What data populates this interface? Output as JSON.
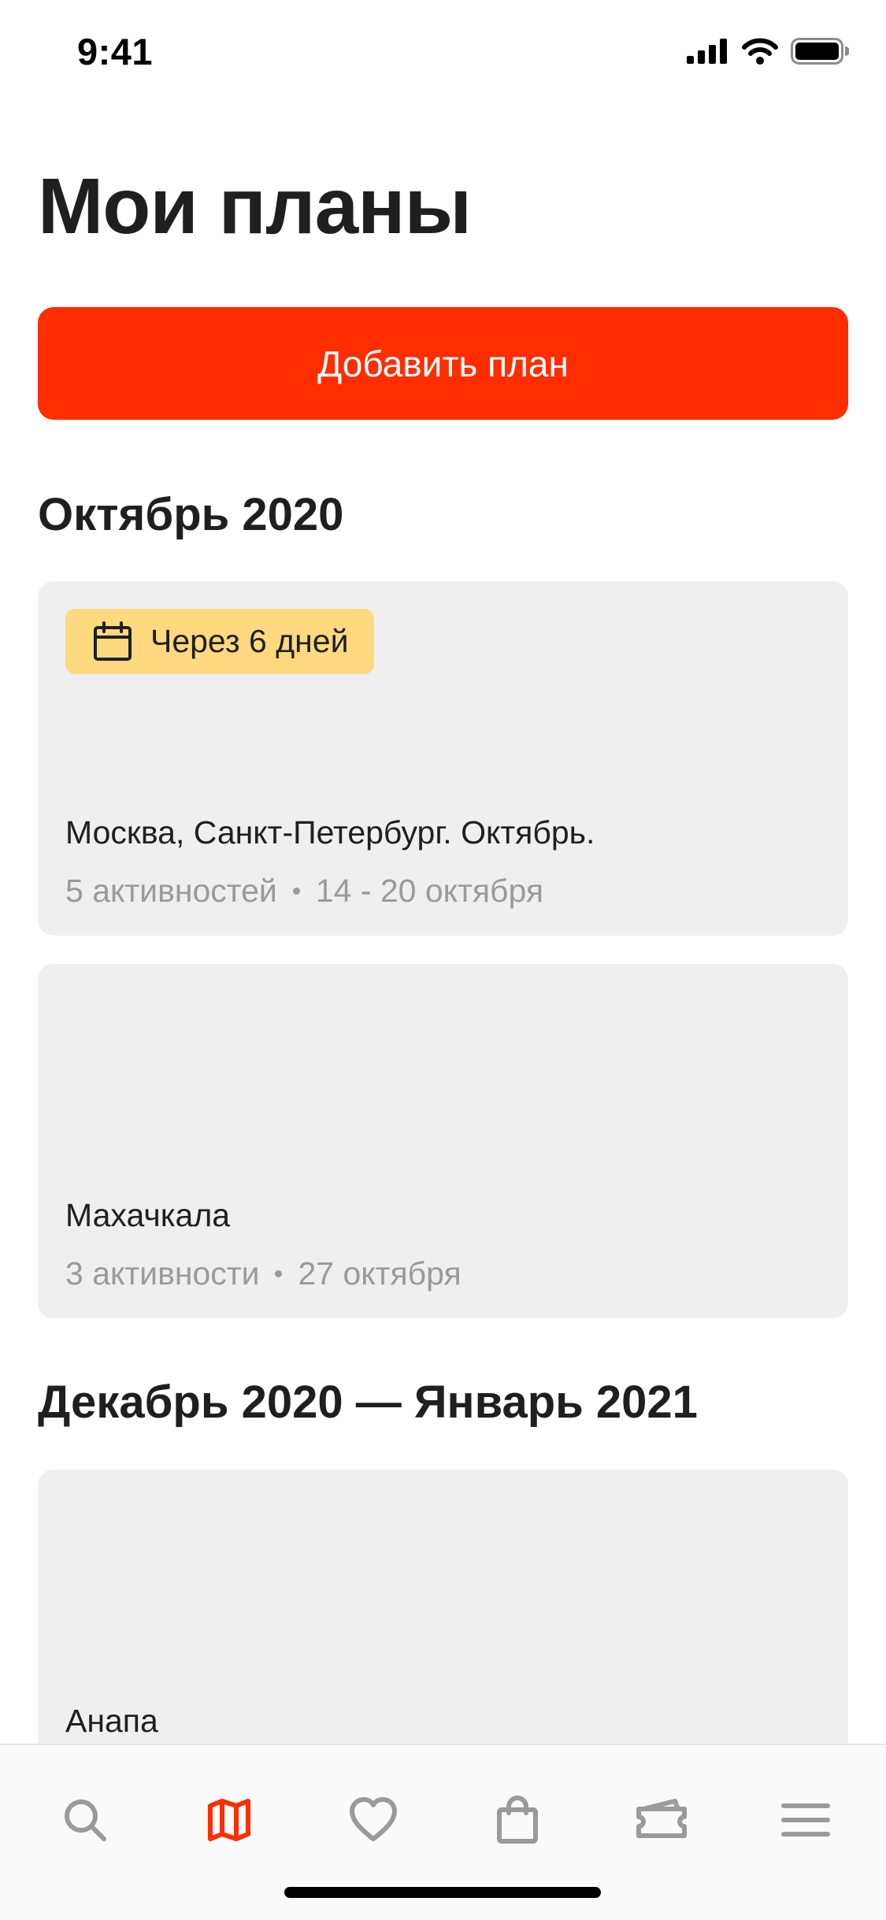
{
  "status_bar": {
    "time": "9:41"
  },
  "page": {
    "title": "Мои планы"
  },
  "actions": {
    "add_plan_label": "Добавить план"
  },
  "sections": [
    {
      "heading": "Октябрь 2020",
      "plans": [
        {
          "badge": "Через 6 дней",
          "title": "Москва, Санкт-Петербург. Октябрь.",
          "activities": "5 активностей",
          "dates": "14 - 20 октября"
        },
        {
          "title": "Махачкала",
          "activities": "3 активности",
          "dates": "27 октября"
        }
      ]
    },
    {
      "heading": "Декабрь 2020 — Январь 2021",
      "plans": [
        {
          "title": "Анапа"
        }
      ]
    }
  ],
  "tab_bar": {
    "tabs": [
      {
        "icon": "search-icon",
        "active": false
      },
      {
        "icon": "map-icon",
        "active": true
      },
      {
        "icon": "heart-icon",
        "active": false
      },
      {
        "icon": "shopping-bag-icon",
        "active": false
      },
      {
        "icon": "ticket-icon",
        "active": false
      },
      {
        "icon": "menu-icon",
        "active": false
      }
    ]
  },
  "colors": {
    "accent": "#ff2d00",
    "badge_bg": "#ffd980",
    "card_bg": "#efefef",
    "text_primary": "#1f1f1f",
    "text_secondary": "#9a9a9a",
    "tab_inactive": "#9a9a9a"
  }
}
